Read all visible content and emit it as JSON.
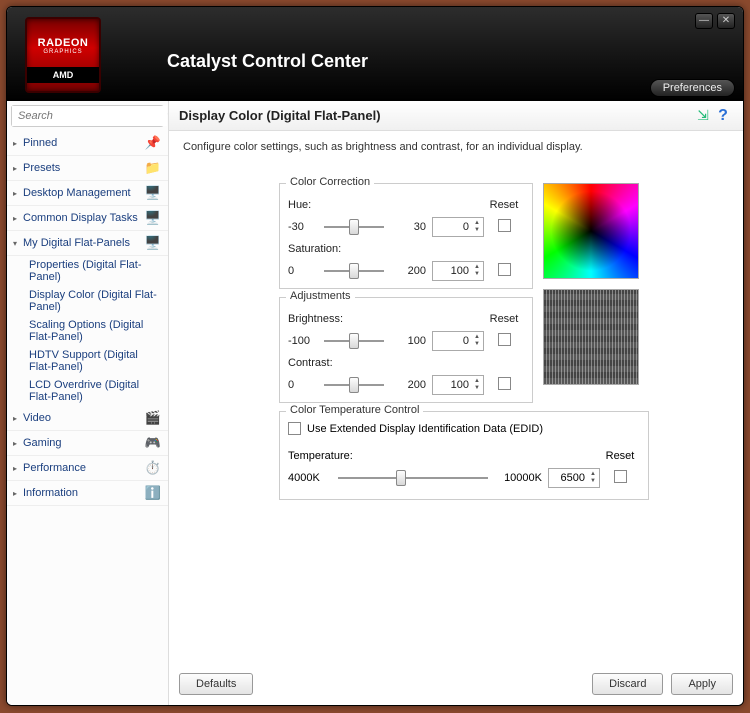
{
  "app": {
    "title": "Catalyst Control Center",
    "logo_line1": "RADEON",
    "logo_line2": "GRAPHICS",
    "logo_line3": "AMD",
    "preferences": "Preferences"
  },
  "search": {
    "placeholder": "Search"
  },
  "nav": {
    "pinned": "Pinned",
    "presets": "Presets",
    "desktop": "Desktop Management",
    "common": "Common Display Tasks",
    "panels": "My Digital Flat-Panels",
    "sub1": "Properties (Digital Flat-Panel)",
    "sub2": "Display Color (Digital Flat-Panel)",
    "sub3": "Scaling Options (Digital Flat-Panel)",
    "sub4": "HDTV Support (Digital Flat-Panel)",
    "sub5": "LCD Overdrive (Digital Flat-Panel)",
    "video": "Video",
    "gaming": "Gaming",
    "performance": "Performance",
    "information": "Information"
  },
  "page": {
    "title": "Display Color (Digital Flat-Panel)",
    "desc": "Configure color settings, such as brightness and contrast, for an individual display."
  },
  "cc": {
    "legend": "Color Correction",
    "hue_label": "Hue:",
    "hue_min": "-30",
    "hue_max": "30",
    "hue_val": "0",
    "sat_label": "Saturation:",
    "sat_min": "0",
    "sat_max": "200",
    "sat_val": "100",
    "reset": "Reset"
  },
  "adj": {
    "legend": "Adjustments",
    "br_label": "Brightness:",
    "br_min": "-100",
    "br_max": "100",
    "br_val": "0",
    "ct_label": "Contrast:",
    "ct_min": "0",
    "ct_max": "200",
    "ct_val": "100",
    "reset": "Reset"
  },
  "temp": {
    "legend": "Color Temperature Control",
    "edid": "Use Extended Display Identification Data (EDID)",
    "label": "Temperature:",
    "min": "4000K",
    "max": "10000K",
    "val": "6500",
    "reset": "Reset"
  },
  "buttons": {
    "defaults": "Defaults",
    "discard": "Discard",
    "apply": "Apply"
  }
}
